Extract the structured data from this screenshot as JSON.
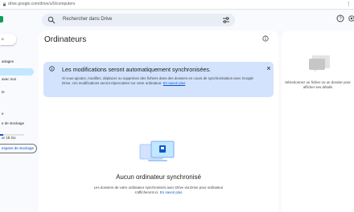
{
  "browser": {
    "url": "drive.google.com/drive/u/0/computers"
  },
  "header": {
    "search_placeholder": "Rechercher dans Drive"
  },
  "sidebar": {
    "new_label": "o",
    "items": [
      {
        "label": "artages",
        "active": false
      },
      {
        "label": "",
        "active": true
      },
      {
        "label": "avec moi",
        "active": false
      },
      {
        "label": "ts",
        "active": false
      },
      {
        "label": "e",
        "active": false
      },
      {
        "label": "e de stockage",
        "active": false
      }
    ],
    "storage_text": "ur 15 Go",
    "storage_button": "espace de stockage"
  },
  "main": {
    "title": "Ordinateurs",
    "banner": {
      "title": "Les modifications seront automatiquement synchronisées.",
      "body": "Si vous ajoutez, modifiez, déplacez ou supprimez des fichiers dans des dossiers en cours de synchronisation avec Google Drive, ces modifications seront répercutées sur votre ordinateur.",
      "link": "En savoir plus"
    },
    "empty_title": "Aucun ordinateur synchronisé",
    "empty_text": "Les dossiers de votre ordinateur synchronisés avec Drive via Drive pour ordinateur s'afficheront ici.",
    "empty_link": "En savoir plus"
  },
  "details": {
    "text": "Sélectionnez un fichier ou un dossier pour afficher ses détails"
  },
  "colors": {
    "accent": "#0b57d0",
    "active_nav": "#c2e7ff",
    "banner": "#d3e3fd"
  }
}
